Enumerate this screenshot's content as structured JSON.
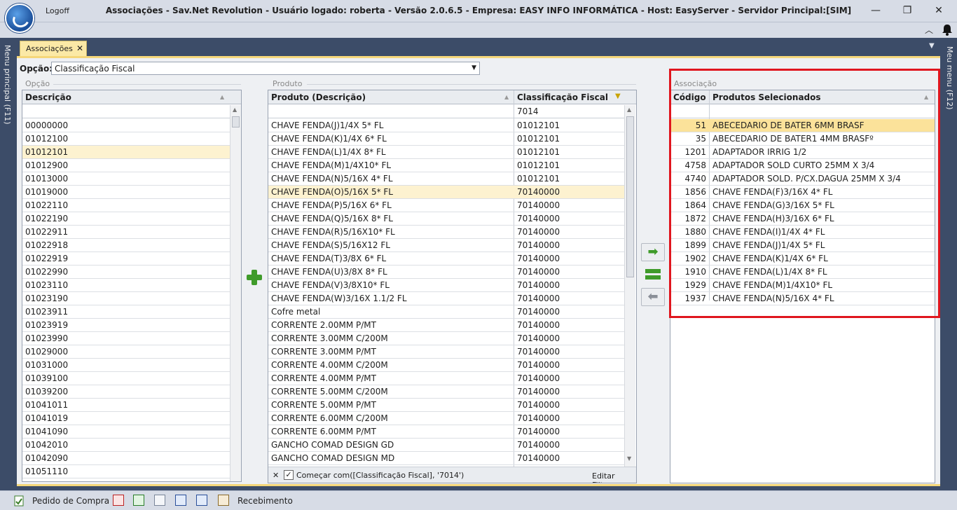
{
  "window": {
    "title": "Associações - Sav.Net Revolution - Usuário logado: roberta - Versão 2.0.6.5 - Empresa: EASY INFO INFORMÁTICA - Host: EasyServer - Servidor Principal:[SIM]",
    "logoff": "Logoff",
    "minimize": "—",
    "maximize": "❐",
    "close": "✕"
  },
  "side": {
    "left_label": "Menu principal (F11)",
    "right_label": "Meu menu (F12)"
  },
  "tab": {
    "label": "Associações",
    "close": "✕"
  },
  "option": {
    "label": "Opção:",
    "value": "Classificação Fiscal"
  },
  "left_grid": {
    "group_title": "Opção",
    "header": "Descrição",
    "filter": "",
    "rows": [
      "00000000",
      "01012100",
      "01012101",
      "01012900",
      "01013000",
      "01019000",
      "01022110",
      "01022190",
      "01022911",
      "01022918",
      "01022919",
      "01022990",
      "01023110",
      "01023190",
      "01023911",
      "01023919",
      "01023990",
      "01029000",
      "01031000",
      "01039100",
      "01039200",
      "01041011",
      "01041019",
      "01041090",
      "01042010",
      "01042090",
      "01051110"
    ]
  },
  "middle_grid": {
    "group_title": "Produto",
    "header_product": "Produto (Descrição)",
    "header_class": "Classificação Fiscal",
    "filter_class": "7014",
    "rows": [
      [
        "CHAVE FENDA(J)1/4X 5* FL",
        "01012101"
      ],
      [
        "CHAVE FENDA(K)1/4X 6* FL",
        "01012101"
      ],
      [
        "CHAVE FENDA(L)1/4X 8* FL",
        "01012101"
      ],
      [
        "CHAVE FENDA(M)1/4X10* FL",
        "01012101"
      ],
      [
        "CHAVE FENDA(N)5/16X 4* FL",
        "01012101"
      ],
      [
        "CHAVE FENDA(O)5/16X 5* FL",
        "70140000"
      ],
      [
        "CHAVE FENDA(P)5/16X 6* FL",
        "70140000"
      ],
      [
        "CHAVE FENDA(Q)5/16X 8* FL",
        "70140000"
      ],
      [
        "CHAVE FENDA(R)5/16X10* FL",
        "70140000"
      ],
      [
        "CHAVE FENDA(S)5/16X12 FL",
        "70140000"
      ],
      [
        "CHAVE FENDA(T)3/8X 6* FL",
        "70140000"
      ],
      [
        "CHAVE FENDA(U)3/8X 8* FL",
        "70140000"
      ],
      [
        "CHAVE FENDA(V)3/8X10* FL",
        "70140000"
      ],
      [
        "CHAVE FENDA(W)3/16X 1.1/2 FL",
        "70140000"
      ],
      [
        "Cofre metal",
        "70140000"
      ],
      [
        "CORRENTE 2.00MM P/MT",
        "70140000"
      ],
      [
        "CORRENTE 3.00MM C/200M",
        "70140000"
      ],
      [
        "CORRENTE 3.00MM P/MT",
        "70140000"
      ],
      [
        "CORRENTE 4.00MM C/200M",
        "70140000"
      ],
      [
        "CORRENTE 4.00MM P/MT",
        "70140000"
      ],
      [
        "CORRENTE 5.00MM C/200M",
        "70140000"
      ],
      [
        "CORRENTE 5.00MM P/MT",
        "70140000"
      ],
      [
        "CORRENTE 6.00MM C/200M",
        "70140000"
      ],
      [
        "CORRENTE 6.00MM P/MT",
        "70140000"
      ],
      [
        "GANCHO COMAD DESIGN GD",
        "70140000"
      ],
      [
        "GANCHO COMAD DESIGN MD",
        "70140000"
      ]
    ],
    "filter_text": "Começar com([Classificação Fiscal], '7014')",
    "edit_filter": "Editar Filtro",
    "filter_close": "✕",
    "filter_check": "✓"
  },
  "right_grid": {
    "group_title": "Associação",
    "header_code": "Código",
    "header_product": "Produtos Selecionados",
    "rows": [
      [
        "51",
        "ABECEDARIO DE BATER 6MM BRASF"
      ],
      [
        "35",
        "ABECEDARIO DE BATER1 4MM BRASFº"
      ],
      [
        "1201",
        "ADAPTADOR IRRIG 1/2"
      ],
      [
        "4758",
        "ADAPTADOR SOLD CURTO 25MM X 3/4"
      ],
      [
        "4740",
        "ADAPTADOR SOLD. P/CX.DAGUA 25MM X 3/4"
      ],
      [
        "1856",
        "CHAVE FENDA(F)3/16X 4* FL"
      ],
      [
        "1864",
        "CHAVE FENDA(G)3/16X 5* FL"
      ],
      [
        "1872",
        "CHAVE FENDA(H)3/16X 6* FL"
      ],
      [
        "1880",
        "CHAVE FENDA(I)1/4X 4* FL"
      ],
      [
        "1899",
        "CHAVE FENDA(J)1/4X 5* FL"
      ],
      [
        "1902",
        "CHAVE FENDA(K)1/4X 6* FL"
      ],
      [
        "1910",
        "CHAVE FENDA(L)1/4X 8* FL"
      ],
      [
        "1929",
        "CHAVE FENDA(M)1/4X10* FL"
      ],
      [
        "1937",
        "CHAVE FENDA(N)5/16X 4* FL"
      ]
    ]
  },
  "buttons": {
    "add": "➡",
    "equal": "=",
    "remove": "⬅"
  },
  "statusbar": {
    "purchase_order": "Pedido de Compra",
    "receipt": "Recebimento"
  },
  "colors": {
    "accent_yellow": "#f5d77a",
    "highlight_red": "#e0161e",
    "green": "#3f9b2a"
  }
}
